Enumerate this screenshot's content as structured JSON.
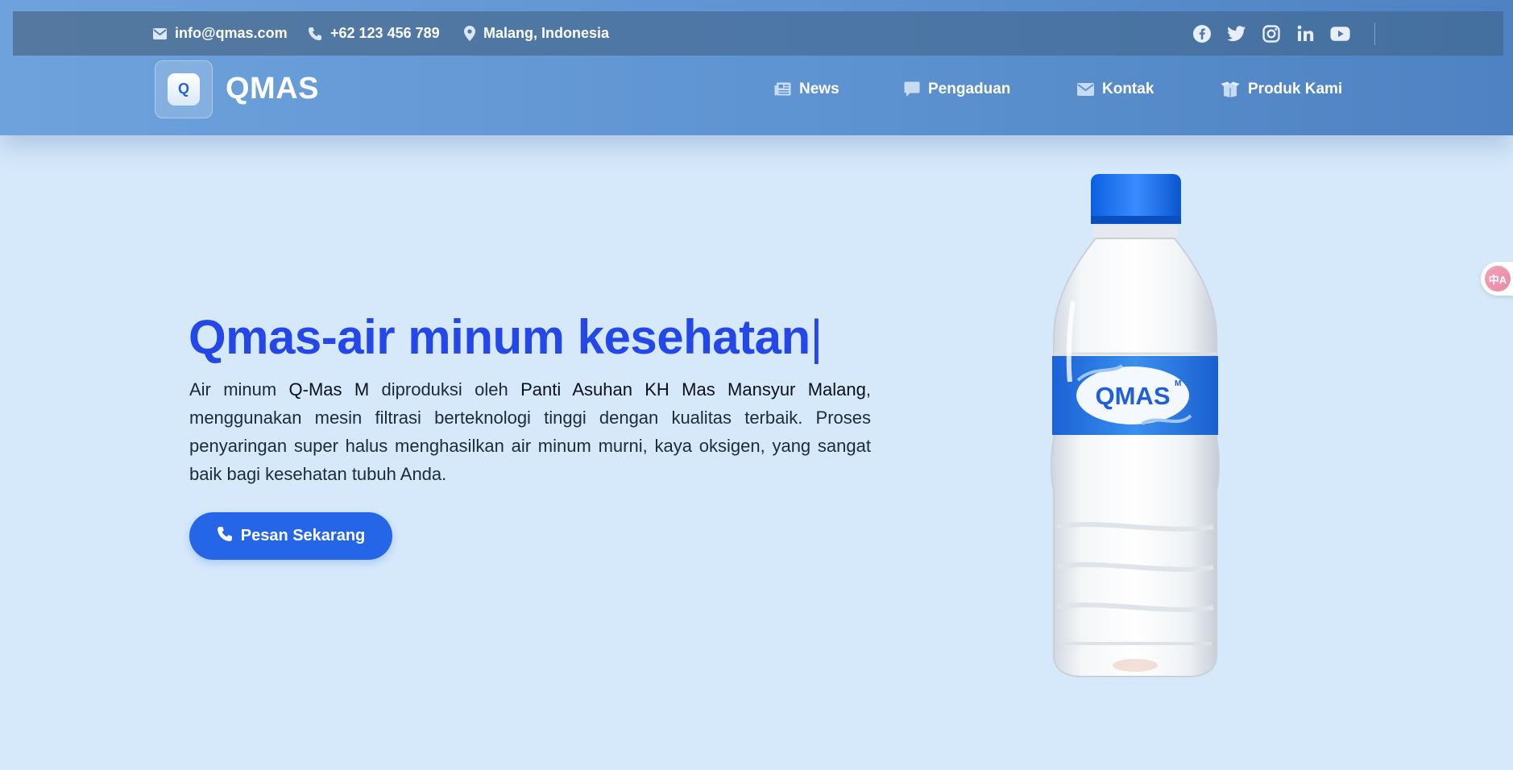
{
  "topbar": {
    "email": "info@qmas.com",
    "phone": "+62 123 456 789",
    "location": "Malang, Indonesia",
    "socials": [
      "facebook-icon",
      "twitter-icon",
      "instagram-icon",
      "linkedin-icon",
      "youtube-icon"
    ]
  },
  "brand": {
    "logo_letter": "Q",
    "name": "QMAS"
  },
  "nav": {
    "items": [
      {
        "label": "News",
        "icon": "newspaper-icon"
      },
      {
        "label": "Pengaduan",
        "icon": "comment-icon"
      },
      {
        "label": "Kontak",
        "icon": "envelope-icon"
      },
      {
        "label": "Produk Kami",
        "icon": "box-icon"
      }
    ]
  },
  "hero": {
    "title": "Qmas-air minum kesehatan",
    "cursor": "|",
    "desc_1": "Air minum ",
    "desc_brand": "Q-Mas M",
    "desc_2": " diproduksi oleh ",
    "desc_org": "Panti Asuhan KH Mas Mansyur Malang",
    "desc_3": ", menggunakan mesin filtrasi berteknologi tinggi dengan kualitas terbaik. Proses penyaringan super halus menghasilkan air minum murni, kaya oksigen, yang sangat baik bagi kesehatan tubuh Anda.",
    "cta_label": "Pesan Sekarang"
  },
  "product_label": {
    "brand": "QMAS",
    "mark": "M"
  },
  "translate": {
    "label": "中A"
  },
  "colors": {
    "header": "#5d93d1",
    "topbar": "#4d77a6",
    "title": "#2447e8",
    "cta": "#2566e8",
    "background": "#d6e9fb"
  }
}
